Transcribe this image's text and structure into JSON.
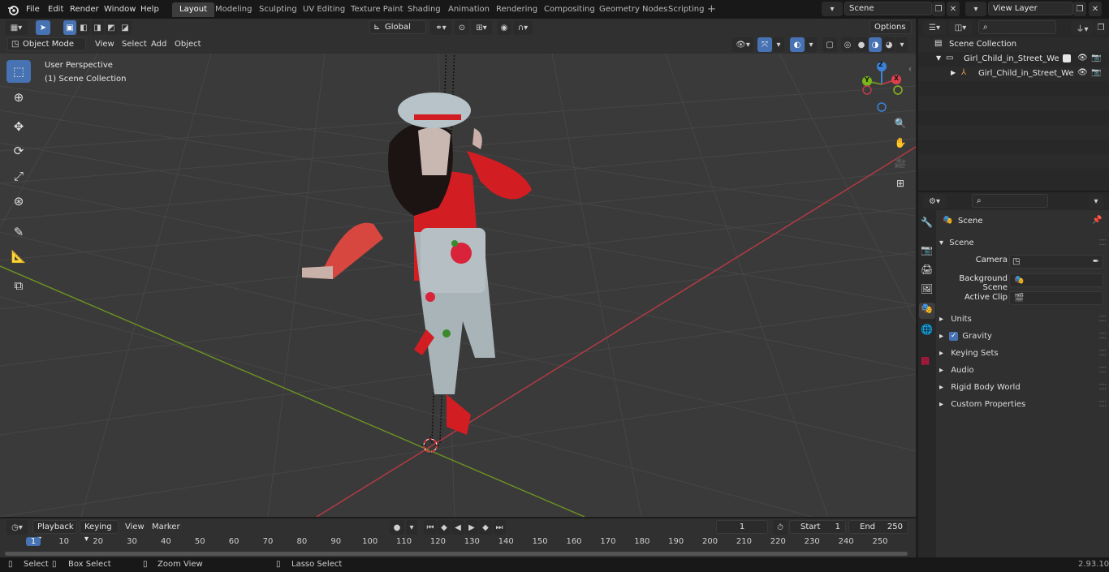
{
  "menubar": {
    "items": [
      "File",
      "Edit",
      "Render",
      "Window",
      "Help"
    ],
    "workspaces": [
      "Layout",
      "Modeling",
      "Sculpting",
      "UV Editing",
      "Texture Paint",
      "Shading",
      "Animation",
      "Rendering",
      "Compositing",
      "Geometry Nodes",
      "Scripting"
    ],
    "active_workspace": "Layout",
    "scene": "Scene",
    "view_layer": "View Layer"
  },
  "viewport_toolbar": {
    "transform_orientation": "Global",
    "options_label": "Options"
  },
  "viewport_header": {
    "mode": "Object Mode",
    "menus": [
      "View",
      "Select",
      "Add",
      "Object"
    ]
  },
  "viewport": {
    "overlay_line1": "User Perspective",
    "overlay_line2": "(1) Scene Collection",
    "gizmo_axes": [
      "X",
      "Y",
      "Z"
    ]
  },
  "outliner": {
    "root": "Scene Collection",
    "items": [
      {
        "label": "Girl_Child_in_Street_Wear_Da"
      },
      {
        "label": "Girl_Child_in_Street_Wea"
      }
    ]
  },
  "properties": {
    "context": "Scene",
    "section": "Scene",
    "fields": [
      {
        "label": "Camera"
      },
      {
        "label": "Background Scene"
      },
      {
        "label": "Active Clip"
      }
    ],
    "panels": [
      "Units",
      "Gravity",
      "Keying Sets",
      "Audio",
      "Rigid Body World",
      "Custom Properties"
    ]
  },
  "timeline": {
    "menus": [
      "Playback",
      "Keying",
      "View",
      "Marker"
    ],
    "current_frame": "1",
    "start_label": "Start",
    "start": "1",
    "end_label": "End",
    "end": "250",
    "ticks": [
      "1",
      "10",
      "20",
      "30",
      "40",
      "50",
      "60",
      "70",
      "80",
      "90",
      "100",
      "110",
      "120",
      "130",
      "140",
      "150",
      "160",
      "170",
      "180",
      "190",
      "200",
      "210",
      "220",
      "230",
      "240",
      "250"
    ]
  },
  "statusbar": {
    "items": [
      "Select",
      "Box Select",
      "Zoom View",
      "Lasso Select"
    ],
    "version": "2.93.10"
  },
  "colors": {
    "accent": "#4772b3",
    "axis_x": "#b33a44",
    "axis_y": "#6b8e23",
    "axis_z": "#3b82d9"
  }
}
